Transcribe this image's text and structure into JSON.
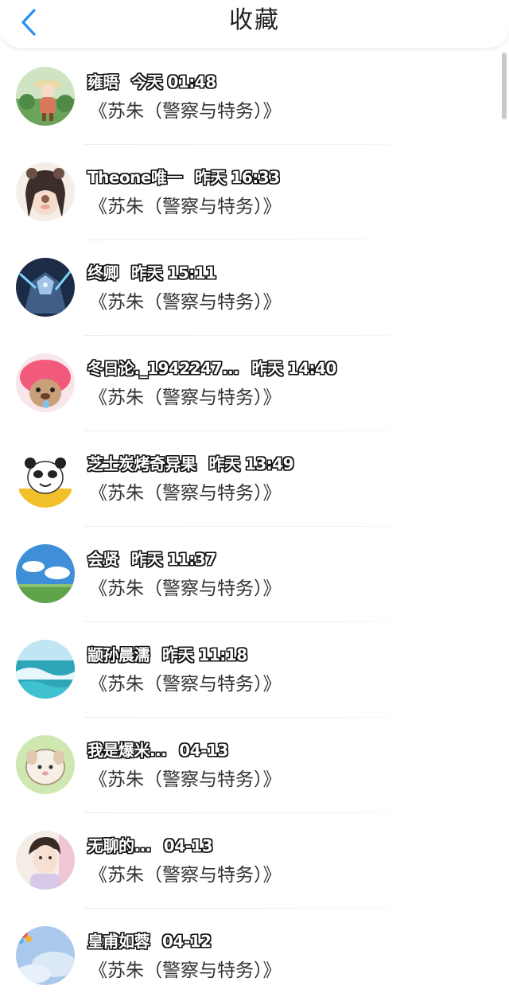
{
  "header": {
    "title": "收藏",
    "back_icon": "chevron-left-icon",
    "accent_color": "#2a8ef0"
  },
  "items": [
    {
      "name": "雍晤",
      "time": "今天 01:48",
      "message": "《苏朱（警察与特务）》",
      "avatar": "cartoon-girl-garden"
    },
    {
      "name": "Theone唯一",
      "time": "昨天 16:33",
      "message": "《苏朱（警察与特务）》",
      "avatar": "girl-bear-ears"
    },
    {
      "name": "终卿",
      "time": "昨天 15:11",
      "message": "《苏朱（警察与特务）》",
      "avatar": "armored-warrior"
    },
    {
      "name": "冬日论._1942247...",
      "time": "昨天 14:40",
      "message": "《苏朱（警察与特务）》",
      "avatar": "pink-plush-bear"
    },
    {
      "name": "芝士炭烤奇异果",
      "time": "昨天 13:49",
      "message": "《苏朱（警察与特务）》",
      "avatar": "panda-meme"
    },
    {
      "name": "会贤",
      "time": "昨天 11:37",
      "message": "《苏朱（警察与特务）》",
      "avatar": "blue-sky-grassland"
    },
    {
      "name": "颛孙晨濡",
      "time": "昨天 11:18",
      "message": "《苏朱（警察与特务）》",
      "avatar": "ocean-wave"
    },
    {
      "name": "我是爆米...",
      "time": "04-13",
      "message": "《苏朱（警察与特务）》",
      "avatar": "cartoon-sheep"
    },
    {
      "name": "无聊的...",
      "time": "04-13",
      "message": "《苏朱（警察与特务）》",
      "avatar": "young-man-portrait"
    },
    {
      "name": "皇甫如蓉",
      "time": "04-12",
      "message": "《苏朱（警察与特务）》",
      "avatar": "sky-balloons"
    }
  ]
}
